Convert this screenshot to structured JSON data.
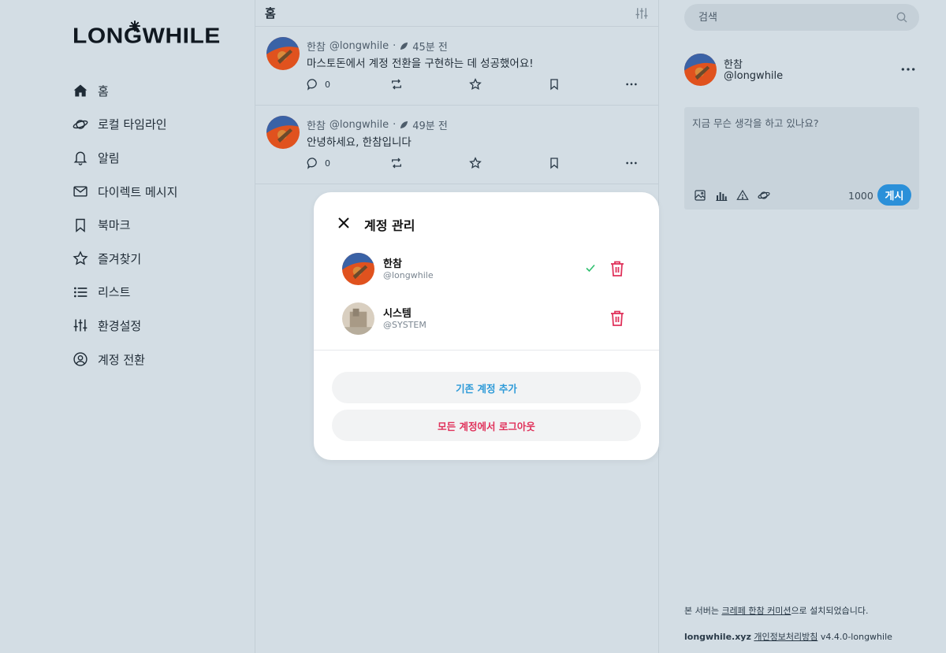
{
  "sidebar": {
    "logo": "LONGWHILE",
    "items": [
      {
        "label": "홈",
        "icon": "home-icon"
      },
      {
        "label": "로컬 타임라인",
        "icon": "planet-icon"
      },
      {
        "label": "알림",
        "icon": "bell-icon"
      },
      {
        "label": "다이렉트 메시지",
        "icon": "envelope-icon"
      },
      {
        "label": "북마크",
        "icon": "bookmark-icon"
      },
      {
        "label": "즐겨찾기",
        "icon": "star-icon"
      },
      {
        "label": "리스트",
        "icon": "list-icon"
      },
      {
        "label": "환경설정",
        "icon": "sliders-icon"
      },
      {
        "label": "계정 전환",
        "icon": "user-circle-icon"
      }
    ]
  },
  "timeline": {
    "title": "홈",
    "posts": [
      {
        "name": "한참",
        "handle": "@longwhile",
        "time": "45분 전",
        "text": "마스토돈에서 계정 전환을 구현하는 데 성공했어요!",
        "replies": "0"
      },
      {
        "name": "한참",
        "handle": "@longwhile",
        "time": "49분 전",
        "text": "안녕하세요, 한참입니다",
        "replies": "0"
      }
    ]
  },
  "right": {
    "search_placeholder": "검색",
    "profile": {
      "name": "한참",
      "handle": "@longwhile"
    },
    "compose": {
      "placeholder": "지금 무슨 생각을 하고 있나요?",
      "char_count": "1000",
      "post_label": "게시"
    },
    "footer": {
      "line1_prefix": "본 서버는 ",
      "line1_link": "크레페 한참 커미션",
      "line1_suffix": "으로 설치되었습니다.",
      "domain": "longwhile.xyz",
      "privacy_link": "개인정보처리방침",
      "version": "v4.4.0-longwhile"
    }
  },
  "modal": {
    "title": "계정 관리",
    "accounts": [
      {
        "name": "한참",
        "handle": "@longwhile",
        "active": true
      },
      {
        "name": "시스템",
        "handle": "@SYSTEM",
        "active": false
      }
    ],
    "add_label": "기존 계정 추가",
    "logout_label": "모든 계정에서 로그아웃"
  },
  "colors": {
    "background": "#d3dde4",
    "accent": "#2b90d9",
    "danger": "#e0325b",
    "check": "#2ebf6e"
  }
}
